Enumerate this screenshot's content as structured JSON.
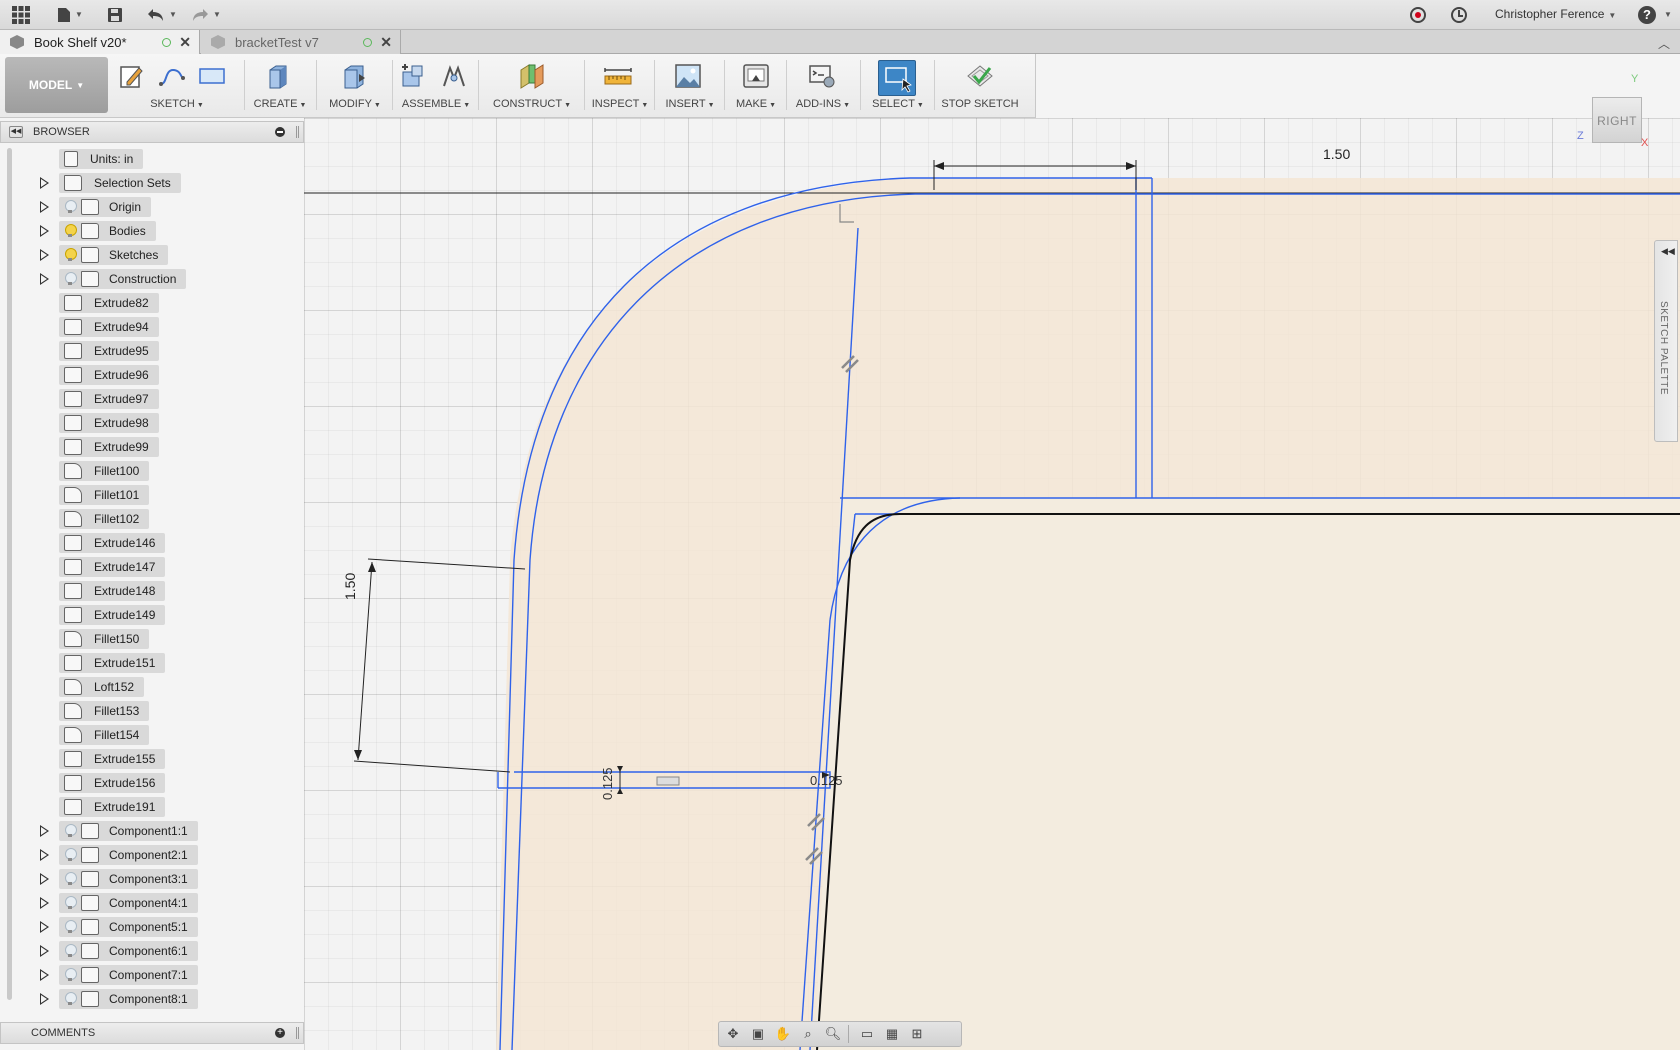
{
  "app": {
    "user_name": "Christopher Ference",
    "record_icon": "record-icon",
    "history_icon": "clock-icon",
    "help_icon": "help-icon"
  },
  "tabs": [
    {
      "label": "Book Shelf v20*",
      "active": true
    },
    {
      "label": "bracketTest v7",
      "active": false
    }
  ],
  "toolbar": {
    "workspace": "MODEL",
    "groups": [
      {
        "label": "SKETCH"
      },
      {
        "label": "CREATE"
      },
      {
        "label": "MODIFY"
      },
      {
        "label": "ASSEMBLE"
      },
      {
        "label": "CONSTRUCT"
      },
      {
        "label": "INSPECT"
      },
      {
        "label": "INSERT"
      },
      {
        "label": "MAKE"
      },
      {
        "label": "ADD-INS"
      },
      {
        "label": "SELECT"
      },
      {
        "label": "STOP SKETCH"
      }
    ]
  },
  "browser": {
    "title": "BROWSER",
    "items": [
      {
        "label": "Units: in",
        "icon": "document-icon"
      },
      {
        "label": "Selection Sets",
        "icon": "folder-icon"
      },
      {
        "label": "Origin",
        "icon": "folder-icon",
        "light": "off"
      },
      {
        "label": "Bodies",
        "icon": "folder-icon",
        "light": "on"
      },
      {
        "label": "Sketches",
        "icon": "folder-icon",
        "light": "on"
      },
      {
        "label": "Construction",
        "icon": "folder-icon",
        "light": "off"
      },
      {
        "label": "Extrude82",
        "icon": "extrude-icon"
      },
      {
        "label": "Extrude94",
        "icon": "extrude-icon"
      },
      {
        "label": "Extrude95",
        "icon": "extrude-icon"
      },
      {
        "label": "Extrude96",
        "icon": "extrude-icon"
      },
      {
        "label": "Extrude97",
        "icon": "extrude-icon"
      },
      {
        "label": "Extrude98",
        "icon": "extrude-icon"
      },
      {
        "label": "Extrude99",
        "icon": "extrude-icon"
      },
      {
        "label": "Fillet100",
        "icon": "fillet-icon"
      },
      {
        "label": "Fillet101",
        "icon": "fillet-icon"
      },
      {
        "label": "Fillet102",
        "icon": "fillet-icon"
      },
      {
        "label": "Extrude146",
        "icon": "extrude-icon"
      },
      {
        "label": "Extrude147",
        "icon": "extrude-icon"
      },
      {
        "label": "Extrude148",
        "icon": "extrude-icon"
      },
      {
        "label": "Extrude149",
        "icon": "extrude-icon"
      },
      {
        "label": "Fillet150",
        "icon": "fillet-icon"
      },
      {
        "label": "Extrude151",
        "icon": "extrude-icon"
      },
      {
        "label": "Loft152",
        "icon": "loft-icon"
      },
      {
        "label": "Fillet153",
        "icon": "fillet-icon"
      },
      {
        "label": "Fillet154",
        "icon": "fillet-icon"
      },
      {
        "label": "Extrude155",
        "icon": "extrude-icon"
      },
      {
        "label": "Extrude156",
        "icon": "extrude-icon"
      },
      {
        "label": "Extrude191",
        "icon": "extrude-icon"
      },
      {
        "label": "Component1:1",
        "icon": "component-icon",
        "light": "off"
      },
      {
        "label": "Component2:1",
        "icon": "component-icon",
        "light": "off"
      },
      {
        "label": "Component3:1",
        "icon": "component-icon",
        "light": "off"
      },
      {
        "label": "Component4:1",
        "icon": "component-icon",
        "light": "off"
      },
      {
        "label": "Component5:1",
        "icon": "component-icon",
        "light": "off"
      },
      {
        "label": "Component6:1",
        "icon": "component-icon",
        "light": "off"
      },
      {
        "label": "Component7:1",
        "icon": "component-icon",
        "light": "off"
      },
      {
        "label": "Component8:1",
        "icon": "component-icon",
        "light": "off"
      }
    ]
  },
  "comments": {
    "title": "COMMENTS"
  },
  "viewcube": {
    "face": "RIGHT",
    "axis_y": "Y",
    "axis_z": "Z",
    "axis_x": "X"
  },
  "sketch_palette": {
    "label": "SKETCH PALETTE"
  },
  "dimensions": {
    "top_width": "1.50",
    "left_height": "1.50",
    "thickness_vertical": "0.125",
    "thickness_horizontal": "0.125"
  },
  "colors": {
    "sketch_line": "#2f62ea",
    "profile_fill": "#f3e6d6",
    "edge_black": "#111111",
    "select_accent": "#3d86c6"
  }
}
